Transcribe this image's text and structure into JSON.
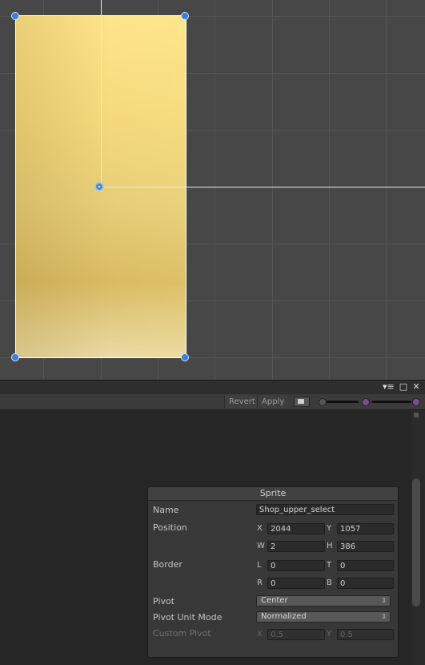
{
  "toolbar": {
    "revert_label": "Revert",
    "apply_label": "Apply",
    "alpha_icon": "rgb-alpha-toggle-icon",
    "zoom_slider_icon": "zoom-slider",
    "mip_slider_icon": "mip-slider"
  },
  "window": {
    "menu_icon": "menu-dropdown-icon",
    "maximize_icon": "maximize-icon",
    "close_icon": "close-icon",
    "menu_glyph": "▾≡",
    "maximize_glyph": "□",
    "close_glyph": "✕"
  },
  "sprite_panel": {
    "title": "Sprite",
    "name_label": "Name",
    "name_value": "Shop_upper_select",
    "position_label": "Position",
    "x_label": "X",
    "x_value": "2044",
    "y_label": "Y",
    "y_value": "1057",
    "w_label": "W",
    "w_value": "2",
    "h_label": "H",
    "h_value": "386",
    "border_label": "Border",
    "l_label": "L",
    "l_value": "0",
    "t_label": "T",
    "t_value": "0",
    "r_label": "R",
    "r_value": "0",
    "b_label": "B",
    "b_value": "0",
    "pivot_label": "Pivot",
    "pivot_value": "Center",
    "pivot_unit_label": "Pivot Unit Mode",
    "pivot_unit_value": "Normalized",
    "custom_pivot_label": "Custom Pivot",
    "custom_x_label": "X",
    "custom_x_value": "0.5",
    "custom_y_label": "Y",
    "custom_y_value": "0.5"
  },
  "colors": {
    "handle": "#3b7fd9",
    "sprite_fill": "#f5d97c",
    "canvas_bg": "#474747",
    "panel_bg": "#383838"
  }
}
